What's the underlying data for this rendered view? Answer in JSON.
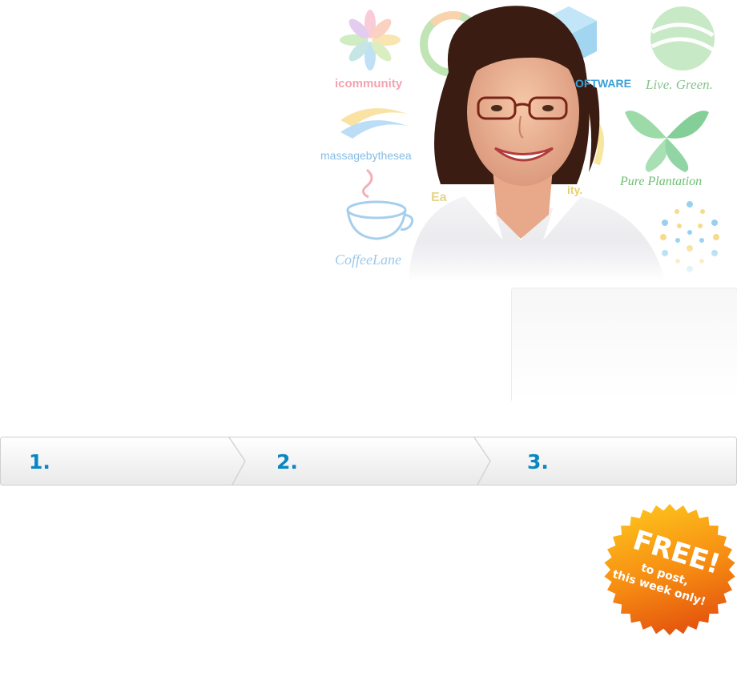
{
  "hero": {
    "logos": [
      {
        "name": "icommunity",
        "text": "icommunity",
        "color": "#f2a0a8"
      },
      {
        "name": "software",
        "text": "OFTWARE",
        "color": "#4aa3d6"
      },
      {
        "name": "live-green",
        "text": "Live. Green.",
        "color": "#7fbf8c"
      },
      {
        "name": "massage-by-the-sea",
        "text": "massagebythesea",
        "color": "#7fb6e0"
      },
      {
        "name": "pure-plantation",
        "text": "Pure Plantation",
        "color": "#6bbf6b"
      },
      {
        "name": "coffee-lane",
        "text": "CoffeeLane",
        "color": "#9fc8e8"
      },
      {
        "name": "ea",
        "text": "Ea",
        "color": "#e5d58a"
      },
      {
        "name": "ity",
        "text": "ity.",
        "color": "#e6d16a"
      }
    ],
    "person": "smiling woman with glasses"
  },
  "steps": [
    {
      "num": "1."
    },
    {
      "num": "2."
    },
    {
      "num": "3."
    }
  ],
  "badge": {
    "title": "FREE!",
    "line1": "to post,",
    "line2": "this week only!",
    "color_top": "#fdbf1a",
    "color_bottom": "#e85d0f"
  },
  "colors": {
    "step_number": "#0a86c2",
    "bar_border": "#cfcfcf"
  }
}
